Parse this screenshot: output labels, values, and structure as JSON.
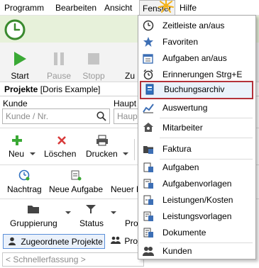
{
  "menubar": {
    "items": [
      "Programm",
      "Bearbeiten",
      "Ansicht",
      "Fenster",
      "Hilfe"
    ],
    "active_index": 3
  },
  "toolbar": {
    "start": "Start",
    "pause": "Pause",
    "stopp": "Stopp",
    "cut": "Zu"
  },
  "projects": {
    "title": "Projekte",
    "context": "[Doris Example]",
    "kunde_label": "Kunde",
    "kunde_placeholder": "Kunde / Nr.",
    "haupt_label": "Haupt",
    "haupt_placeholder": "Haupt"
  },
  "actions": {
    "neu": "Neu",
    "loeschen": "Löschen",
    "drucken": "Drucken",
    "nachtrag": "Nachtrag",
    "neue_aufgabe": "Neue Aufgabe",
    "neuer_k": "Neuer K",
    "gruppierung": "Gruppierung",
    "status": "Status",
    "proj_cut": "Pro"
  },
  "tabs": {
    "assigned": "Zugeordnete Projekte",
    "other": "Proj"
  },
  "quick_entry": {
    "placeholder": "< Schnellerfassung >"
  },
  "fenster_menu": {
    "items": [
      {
        "label": "Zeitleiste an/aus",
        "icon": "clock-icon"
      },
      {
        "label": "Favoriten",
        "icon": "star-icon"
      },
      {
        "label": "Aufgaben an/aus",
        "icon": "tasks-icon"
      },
      {
        "label": "Erinnerungen Strg+E",
        "icon": "alarm-clock-icon"
      },
      {
        "label": "Buchungsarchiv",
        "icon": "archive-icon"
      },
      {
        "label": "Auswertung",
        "icon": "chart-icon"
      },
      {
        "label": "Mitarbeiter",
        "icon": "people-icon"
      },
      {
        "label": "Faktura",
        "icon": "invoice-icon"
      },
      {
        "label": "Aufgaben",
        "icon": "task-list-icon"
      },
      {
        "label": "Aufgabenvorlagen",
        "icon": "task-template-icon"
      },
      {
        "label": "Leistungen/Kosten",
        "icon": "services-icon"
      },
      {
        "label": "Leistungsvorlagen",
        "icon": "service-template-icon"
      },
      {
        "label": "Dokumente",
        "icon": "documents-icon"
      },
      {
        "label": "Kunden",
        "icon": "customers-icon"
      }
    ],
    "highlighted_index": 4,
    "highlight_border_color": "#b3323a"
  },
  "colors": {
    "accent_green": "#3aa935",
    "delete_red": "#d83a3a",
    "timeline_band": "#e7f1da"
  }
}
